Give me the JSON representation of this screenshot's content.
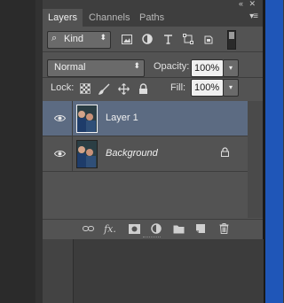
{
  "window": {
    "collapse_icon": "«",
    "close_icon": "✕"
  },
  "tabs": [
    {
      "label": "Layers",
      "active": true
    },
    {
      "label": "Channels",
      "active": false
    },
    {
      "label": "Paths",
      "active": false
    }
  ],
  "tab_menu_icon": "▾≡",
  "filter": {
    "search_icon": "⌕",
    "kind_label": "Kind",
    "dropdown_arrow": "⬍",
    "icons": [
      "image-filter-icon",
      "adjustment-filter-icon",
      "type-filter-icon",
      "shape-filter-icon",
      "smart-object-filter-icon"
    ]
  },
  "blend": {
    "mode": "Normal",
    "arrow": "⬍",
    "opacity_label": "Opacity:",
    "opacity_value": "100%",
    "opacity_btn": "▾"
  },
  "lock": {
    "label": "Lock:",
    "fill_label": "Fill:",
    "fill_value": "100%",
    "fill_btn": "▾"
  },
  "layers": [
    {
      "name": "Layer 1",
      "selected": true,
      "visible": true,
      "locked": false
    },
    {
      "name": "Background",
      "selected": false,
      "visible": true,
      "locked": true,
      "italic": true
    }
  ],
  "bottom_icons": [
    "link-layers-icon",
    "fx-icon",
    "add-mask-icon",
    "adjustment-layer-icon",
    "new-group-icon",
    "new-layer-icon",
    "delete-layer-icon"
  ],
  "bottom_labels": {
    "fx": "fx."
  },
  "colors": {
    "panel": "#535353",
    "selected_row": "#5c6b82",
    "right_bg": "#1f56b8"
  }
}
